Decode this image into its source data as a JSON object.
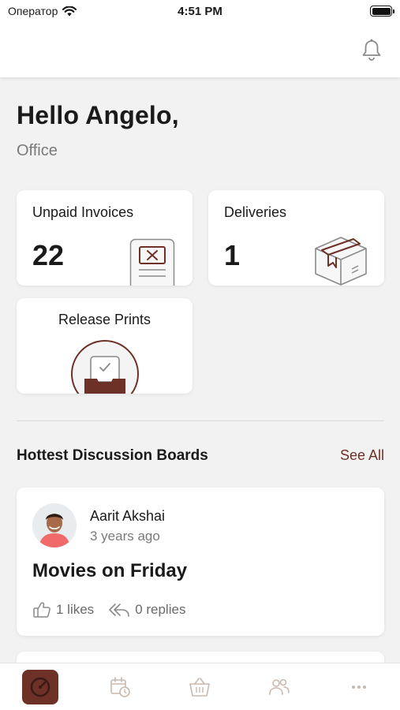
{
  "status_bar": {
    "carrier": "Оператор",
    "time": "4:51 PM"
  },
  "header": {
    "greeting": "Hello Angelo,",
    "subtitle": "Office"
  },
  "cards": {
    "unpaid": {
      "label": "Unpaid Invoices",
      "count": "22",
      "icon": "invoice-icon"
    },
    "deliveries": {
      "label": "Deliveries",
      "count": "1",
      "icon": "package-icon"
    },
    "release": {
      "label": "Release Prints",
      "icon": "print-tray-icon"
    }
  },
  "section": {
    "title": "Hottest Discussion Boards",
    "see_all": "See All"
  },
  "post": {
    "author": "Aarit Akshai",
    "time": "3 years ago",
    "title": "Movies on Friday",
    "likes": "1 likes",
    "replies": "0 replies"
  },
  "tabs": [
    {
      "name": "dashboard",
      "icon": "dashboard-icon",
      "active": true
    },
    {
      "name": "schedule",
      "icon": "calendar-clock-icon",
      "active": false
    },
    {
      "name": "shop",
      "icon": "basket-icon",
      "active": false
    },
    {
      "name": "people",
      "icon": "people-icon",
      "active": false
    },
    {
      "name": "more",
      "icon": "more-icon",
      "active": false
    }
  ],
  "colors": {
    "accent": "#6e3127",
    "muted_icon": "#c8b8ad",
    "background": "#f2f2f2"
  }
}
